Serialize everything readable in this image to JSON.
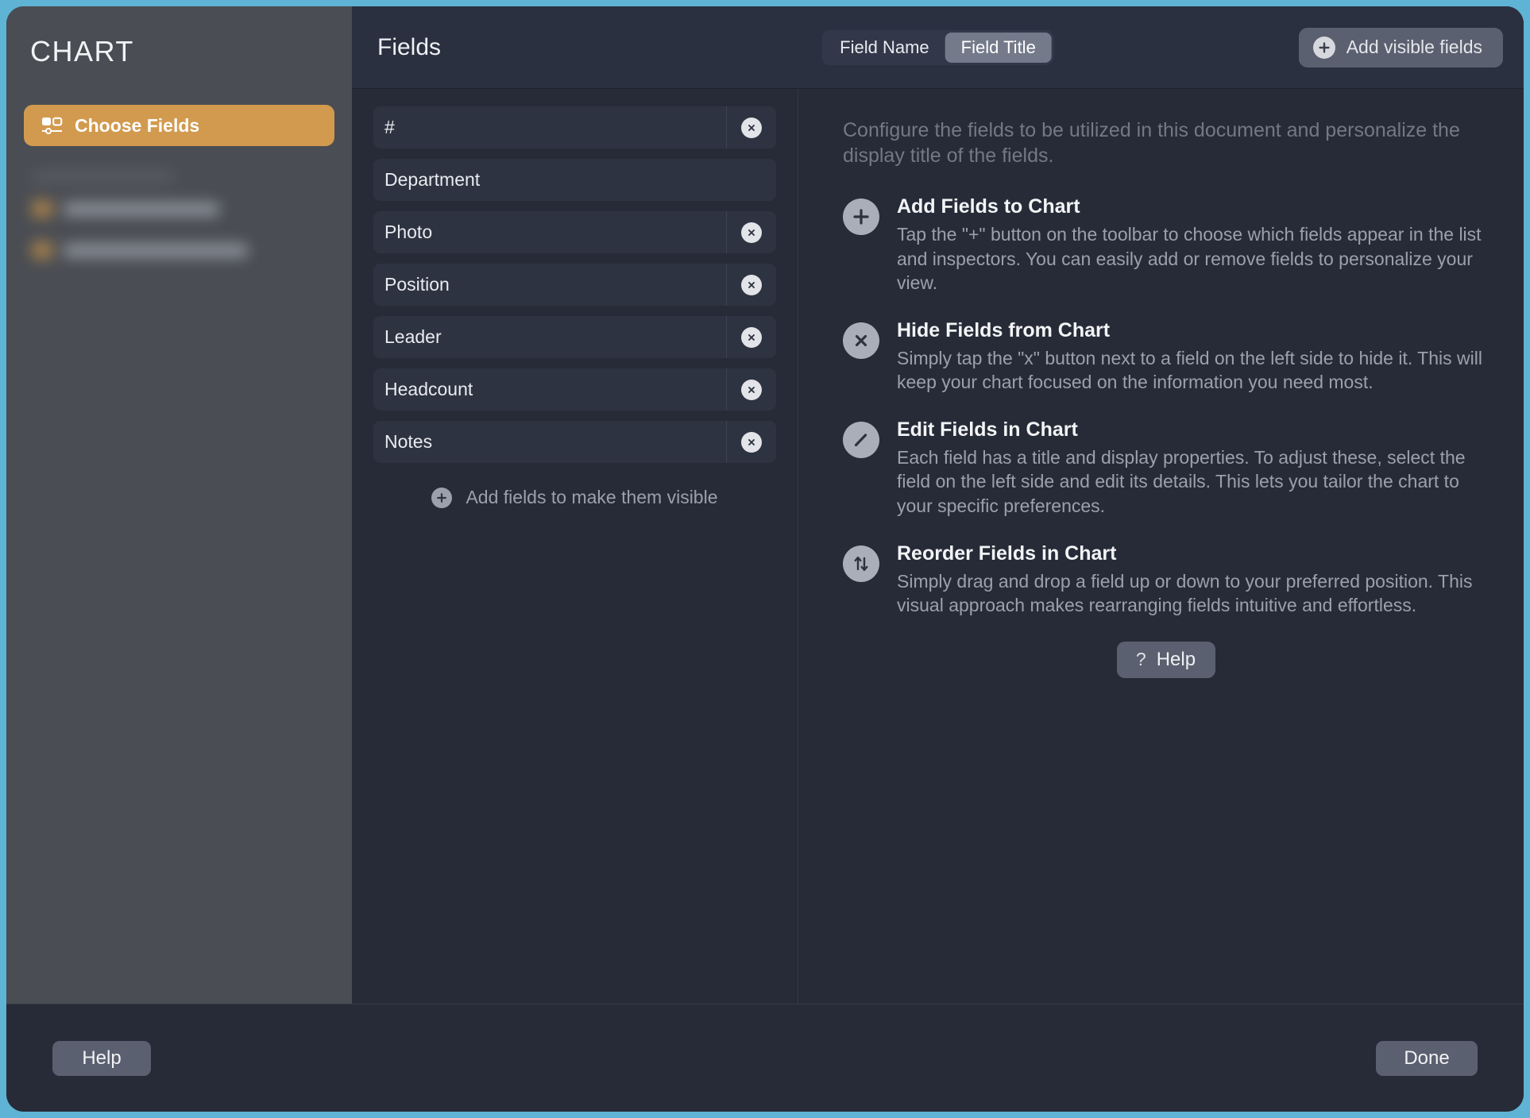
{
  "sidebar": {
    "title": "CHART",
    "choose_fields_label": "Choose Fields",
    "choose_fields_icon": "fields-layout-icon",
    "accent_color": "#d29a4f"
  },
  "header": {
    "title": "Fields",
    "segmented": {
      "options": [
        "Field Name",
        "Field Title"
      ],
      "selected": "Field Title"
    },
    "add_visible_fields_label": "Add visible fields",
    "add_visible_fields_icon": "circle-plus-icon"
  },
  "fields_list": {
    "rows": [
      {
        "title": "#",
        "removable": true
      },
      {
        "title": "Department",
        "removable": false
      },
      {
        "title": "Photo",
        "removable": true
      },
      {
        "title": "Position",
        "removable": true
      },
      {
        "title": "Leader",
        "removable": true
      },
      {
        "title": "Headcount",
        "removable": true
      },
      {
        "title": "Notes",
        "removable": true
      }
    ],
    "add_hint_label": "Add fields to make them visible",
    "add_hint_icon": "circle-plus-icon"
  },
  "info": {
    "intro": "Configure the fields to be utilized in this document and personalize the display title of the fields.",
    "items": [
      {
        "icon": "plus-icon",
        "title": "Add Fields to Chart",
        "desc": "Tap the \"+\" button on the toolbar to choose which fields appear in the list and inspectors. You can easily add or remove fields to personalize your view."
      },
      {
        "icon": "close-x-icon",
        "title": "Hide Fields from Chart",
        "desc": "Simply tap the \"x\" button next to a field on the left side to hide it. This will keep your chart focused on the information you need most."
      },
      {
        "icon": "pencil-icon",
        "title": "Edit Fields in Chart",
        "desc": "Each field has a title and display properties. To adjust these, select the field on the left side and edit its details. This lets you tailor the chart to your specific preferences."
      },
      {
        "icon": "sort-updown-icon",
        "title": "Reorder Fields in Chart",
        "desc": "Simply drag and drop a field up or down to your preferred position. This visual approach makes rearranging fields intuitive and effortless."
      }
    ],
    "help_button": {
      "glyph": "?",
      "label": "Help"
    }
  },
  "footer": {
    "help_label": "Help",
    "done_label": "Done"
  }
}
